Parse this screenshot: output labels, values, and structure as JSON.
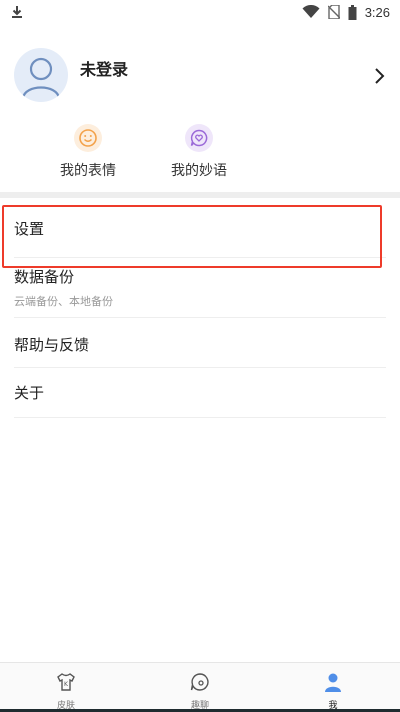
{
  "status_bar": {
    "time": "3:26",
    "icons": [
      "download-icon",
      "wifi-icon",
      "no-sim-icon",
      "battery-icon"
    ]
  },
  "profile": {
    "name": "未登录",
    "avatar_icon": "user-avatar-icon"
  },
  "quick_actions": [
    {
      "label": "我的表情",
      "icon": "smile-icon",
      "color": "#f3a24a"
    },
    {
      "label": "我的妙语",
      "icon": "heart-chat-icon",
      "color": "#9b6ad8"
    }
  ],
  "menu": {
    "settings": {
      "label": "设置"
    },
    "backup": {
      "label": "数据备份",
      "sublabel": "云端备份、本地备份"
    },
    "help": {
      "label": "帮助与反馈"
    },
    "about": {
      "label": "关于"
    }
  },
  "bottom_nav": [
    {
      "label": "皮肤",
      "icon": "shirt-icon",
      "active": false
    },
    {
      "label": "趣聊",
      "icon": "chat-bubble-icon",
      "active": false
    },
    {
      "label": "我",
      "icon": "person-icon",
      "active": true
    }
  ],
  "colors": {
    "highlight": "#ee3b2a",
    "accent": "#4f8ee8",
    "divider": "#eeeeee"
  }
}
